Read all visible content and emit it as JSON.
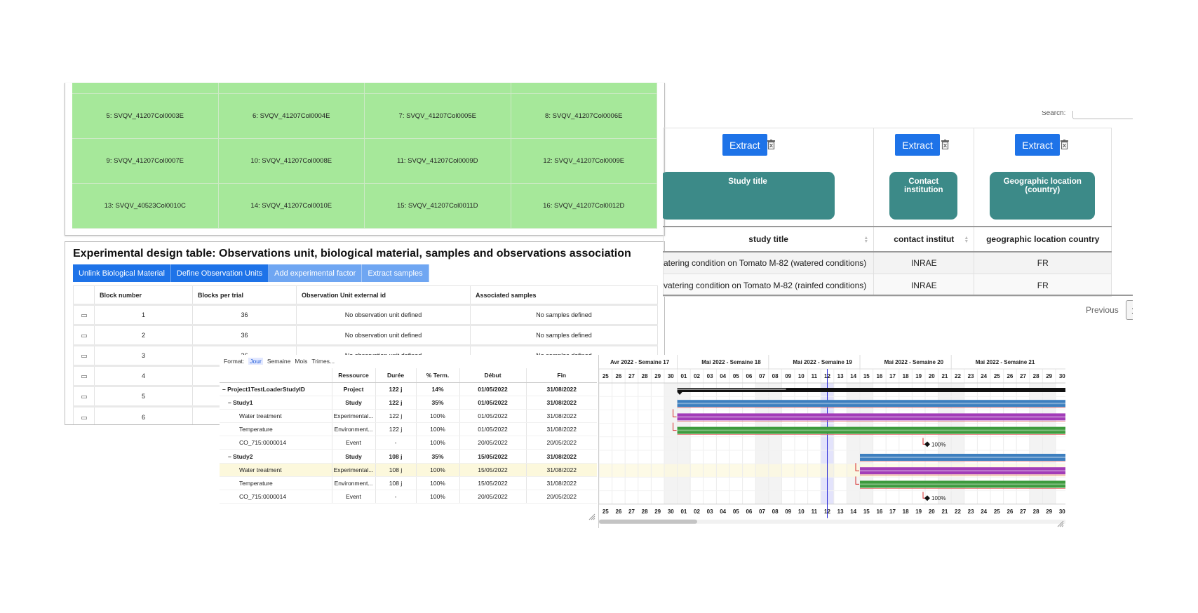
{
  "sample_grid": {
    "cells": [
      "5: SVQV_41207Col0003E",
      "6: SVQV_41207Col0004E",
      "7: SVQV_41207Col0005E",
      "8: SVQV_41207Col0006E",
      "9: SVQV_41207Col0007E",
      "10: SVQV_41207Col0008E",
      "11: SVQV_41207Col0009D",
      "12: SVQV_41207Col0009E",
      "13: SVQV_40523Col0010C",
      "14: SVQV_41207Col0010E",
      "15: SVQV_41207Col0011D",
      "16: SVQV_41207Col0012D"
    ],
    "cell_color": "#a6e89a"
  },
  "experimental_design": {
    "title": "Experimental design table: Observations unit, biological material, samples and observations association",
    "buttons": [
      "Unlink Biological Material",
      "Define Observation Units",
      "Add experimental factor",
      "Extract samples"
    ],
    "columns": [
      "",
      "Block number",
      "Blocks per trial",
      "Observation Unit external id",
      "Associated samples"
    ],
    "rows": [
      {
        "block": "1",
        "per_trial": "36",
        "obs_unit": "No observation unit defined",
        "samples": "No samples defined"
      },
      {
        "block": "2",
        "per_trial": "36",
        "obs_unit": "No observation unit defined",
        "samples": "No samples defined"
      },
      {
        "block": "3",
        "per_trial": "36",
        "obs_unit": "No observation unit defined",
        "samples": "No samples defined"
      },
      {
        "block": "4",
        "per_trial": "",
        "obs_unit": "",
        "samples": ""
      },
      {
        "block": "5",
        "per_trial": "",
        "obs_unit": "",
        "samples": ""
      },
      {
        "block": "6",
        "per_trial": "",
        "obs_unit": "",
        "samples": ""
      }
    ]
  },
  "datatable": {
    "search_label": "Search:",
    "extract_label": "Extract",
    "field_boxes": [
      "Study title",
      "Contact institution",
      "Geographic location (country)"
    ],
    "columns": [
      "study title",
      "contact institut",
      "geographic location country"
    ],
    "rows": [
      [
        "atering condition on Tomato M-82 (watered conditions)",
        "INRAE",
        "FR"
      ],
      [
        "vatering condition on Tomato M-82 (rainfed conditions)",
        "INRAE",
        "FR"
      ]
    ],
    "previous_label": "Previous",
    "page": "1"
  },
  "gantt": {
    "format_label": "Format:",
    "formats": [
      "Jour",
      "Semaine",
      "Mois",
      "Trimes..."
    ],
    "selected_format": "Jour",
    "columns": [
      "",
      "Ressource",
      "Durée",
      "% Term.",
      "Début",
      "Fin"
    ],
    "rows": [
      {
        "name": "– Project1TestLoaderStudyID",
        "resource": "Project",
        "duration": "122 j",
        "progress": "14%",
        "start": "01/05/2022",
        "end": "31/08/2022",
        "bold": true
      },
      {
        "name": "– Study1",
        "resource": "Study",
        "duration": "122 j",
        "progress": "35%",
        "start": "01/05/2022",
        "end": "31/08/2022",
        "bold": true
      },
      {
        "name": "Water treatment",
        "resource": "Experimental...",
        "duration": "122 j",
        "progress": "100%",
        "start": "01/05/2022",
        "end": "31/08/2022"
      },
      {
        "name": "Temperature",
        "resource": "Environment...",
        "duration": "122 j",
        "progress": "100%",
        "start": "01/05/2022",
        "end": "31/08/2022"
      },
      {
        "name": "CO_715:0000014",
        "resource": "Event",
        "duration": "-",
        "progress": "100%",
        "start": "20/05/2022",
        "end": "20/05/2022"
      },
      {
        "name": "– Study2",
        "resource": "Study",
        "duration": "108 j",
        "progress": "35%",
        "start": "15/05/2022",
        "end": "31/08/2022",
        "bold": true
      },
      {
        "name": "Water treatment",
        "resource": "Experimental...",
        "duration": "108 j",
        "progress": "100%",
        "start": "15/05/2022",
        "end": "31/08/2022",
        "highlight": true
      },
      {
        "name": "Temperature",
        "resource": "Environment...",
        "duration": "108 j",
        "progress": "100%",
        "start": "15/05/2022",
        "end": "31/08/2022"
      },
      {
        "name": "CO_715:0000014",
        "resource": "Event",
        "duration": "-",
        "progress": "100%",
        "start": "20/05/2022",
        "end": "20/05/2022"
      }
    ],
    "weeks": [
      "Avr 2022 - Semaine 17",
      "Mai 2022 - Semaine 18",
      "Mai 2022 - Semaine 19",
      "Mai 2022 - Semaine 20",
      "Mai 2022 - Semaine 21"
    ],
    "days": [
      "25",
      "26",
      "27",
      "28",
      "29",
      "30",
      "01",
      "02",
      "03",
      "04",
      "05",
      "06",
      "07",
      "08",
      "09",
      "10",
      "11",
      "12",
      "13",
      "14",
      "15",
      "16",
      "17",
      "18",
      "19",
      "20",
      "21",
      "22",
      "23",
      "24",
      "25",
      "26",
      "27",
      "28",
      "29",
      "30"
    ],
    "today": "12",
    "milestone_label": "100%",
    "bars": [
      {
        "row": 0,
        "start_day": "01",
        "color": "#111111",
        "progress": 0.14
      },
      {
        "row": 1,
        "start_day": "01",
        "color": "#3d7fbf"
      },
      {
        "row": 2,
        "start_day": "01",
        "color": "#a23cb8"
      },
      {
        "row": 3,
        "start_day": "01",
        "color": "#3d9a3d"
      },
      {
        "row": 5,
        "start_day": "15",
        "color": "#3d7fbf"
      },
      {
        "row": 6,
        "start_day": "15",
        "color": "#a23cb8"
      },
      {
        "row": 7,
        "start_day": "15",
        "color": "#3d9a3d"
      }
    ],
    "milestones": [
      {
        "row": 4,
        "day": "20"
      },
      {
        "row": 8,
        "day": "20"
      }
    ]
  }
}
